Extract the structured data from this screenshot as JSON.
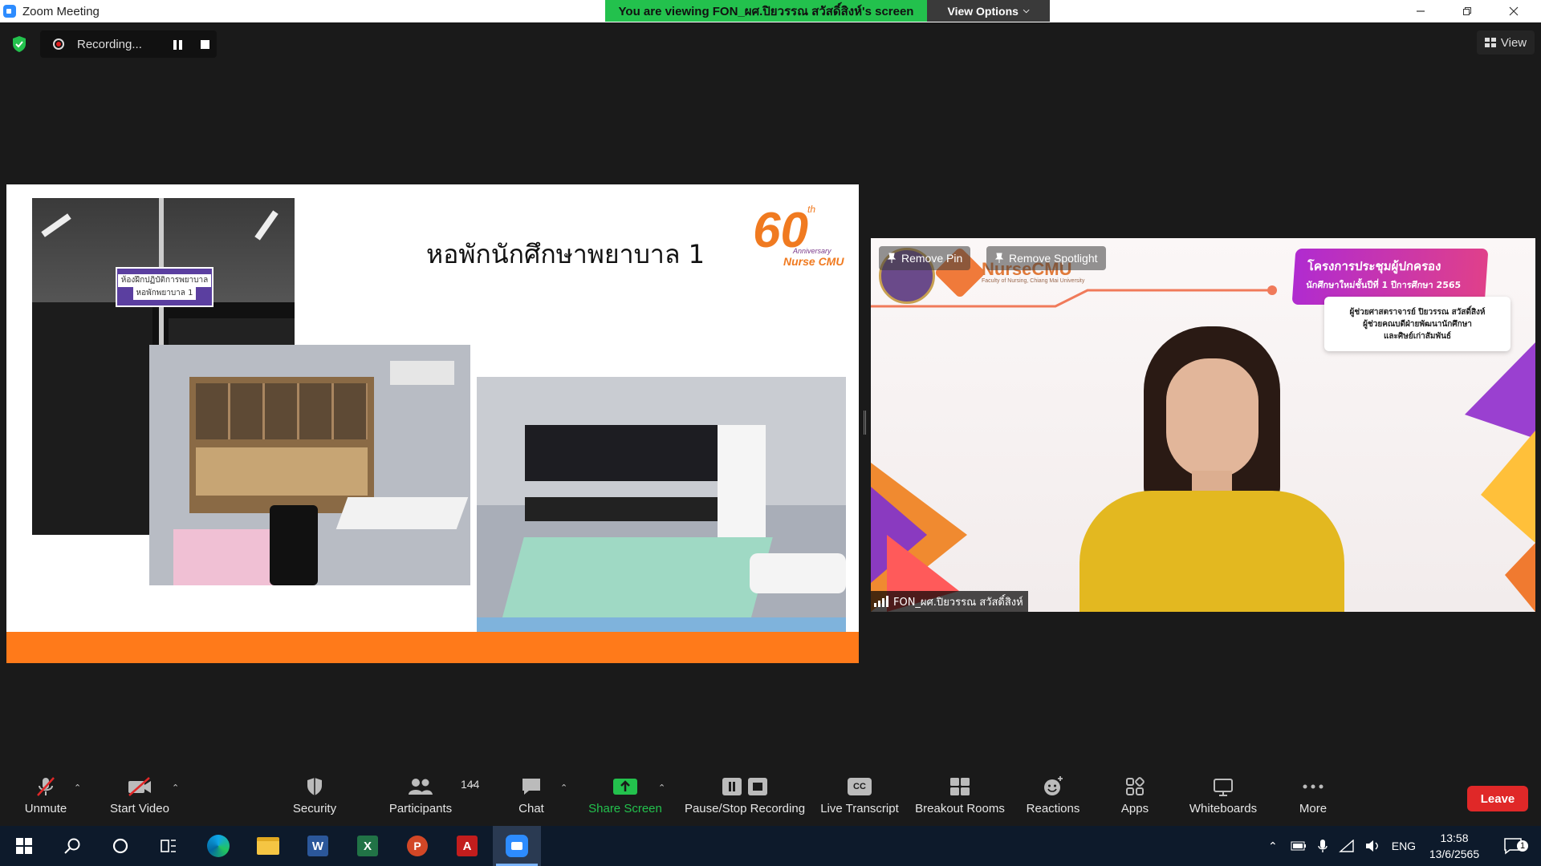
{
  "window": {
    "title": "Zoom Meeting"
  },
  "share_banner": {
    "viewing_text": "You are viewing FON_ผศ.ปิยวรรณ สวัสดิ์สิงห์'s screen",
    "view_options": "View Options"
  },
  "recording": {
    "label": "Recording..."
  },
  "view_button": {
    "label": "View"
  },
  "slide": {
    "title": "หอพักนักศึกษาพยาบาล 1",
    "logo_number": "60",
    "logo_sup": "th",
    "logo_line1": "Anniversary",
    "logo_line2": "Nurse CMU",
    "sign_line1": "ห้องฝึกปฏิบัติการพยาบาล",
    "sign_line2": "หอพักพยาบาล 1"
  },
  "speaker": {
    "name": "FON_ผศ.ปิยวรรณ สวัสดิ์สิงห์",
    "remove_pin": "Remove Pin",
    "remove_spotlight": "Remove Spotlight",
    "brand": "NurseCMU",
    "brand_sub": "Faculty of Nursing, Chiang Mai University",
    "banner_line1": "โครงการประชุมผู้ปกครอง",
    "banner_line2": "นักศึกษาใหม่ชั้นปีที่ 1 ปีการศึกษา 2565",
    "card_line1": "ผู้ช่วยศาสตราจารย์ ปิยวรรณ สวัสดิ์สิงห์",
    "card_line2": "ผู้ช่วยคณบดีฝ่ายพัฒนานักศึกษา",
    "card_line3": "และศิษย์เก่าสัมพันธ์"
  },
  "toolbar": {
    "unmute": "Unmute",
    "start_video": "Start Video",
    "security": "Security",
    "participants": "Participants",
    "participants_count": "144",
    "chat": "Chat",
    "share_screen": "Share Screen",
    "pause_stop_recording": "Pause/Stop Recording",
    "live_transcript": "Live Transcript",
    "cc": "CC",
    "breakout_rooms": "Breakout Rooms",
    "reactions": "Reactions",
    "apps": "Apps",
    "whiteboards": "Whiteboards",
    "more": "More",
    "leave": "Leave"
  },
  "taskbar": {
    "language": "ENG",
    "time": "13:58",
    "date": "13/6/2565",
    "notifications": "1"
  },
  "colors": {
    "accent_green": "#23c14d",
    "leave_red": "#e02828",
    "slide_orange": "#ff7a1a",
    "zoom_blue": "#2d8cff"
  }
}
